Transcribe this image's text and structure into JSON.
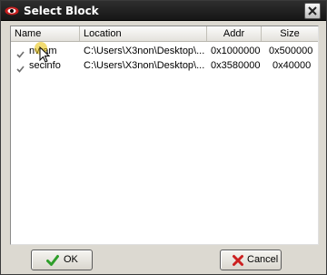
{
  "window": {
    "title": "Select Block",
    "app_icon": "red-eye-icon",
    "close_icon": "close-icon"
  },
  "table": {
    "columns": [
      "Name",
      "Location",
      "Addr",
      "Size"
    ],
    "rows": [
      {
        "checked": true,
        "name": "nvram",
        "location": "C:\\Users\\X3non\\Desktop\\...",
        "addr": "0x1000000",
        "size": "0x500000"
      },
      {
        "checked": true,
        "name": "secinfo",
        "location": "C:\\Users\\X3non\\Desktop\\...",
        "addr": "0x3580000",
        "size": "0x40000"
      }
    ]
  },
  "buttons": {
    "ok_label": "OK",
    "ok_icon": "green-checkmark-icon",
    "cancel_label": "Cancel",
    "cancel_icon": "red-x-icon"
  },
  "colors": {
    "titlebar": "#1e1e1e",
    "ok_check": "#2e9e2a",
    "cancel_x": "#cc2020"
  }
}
